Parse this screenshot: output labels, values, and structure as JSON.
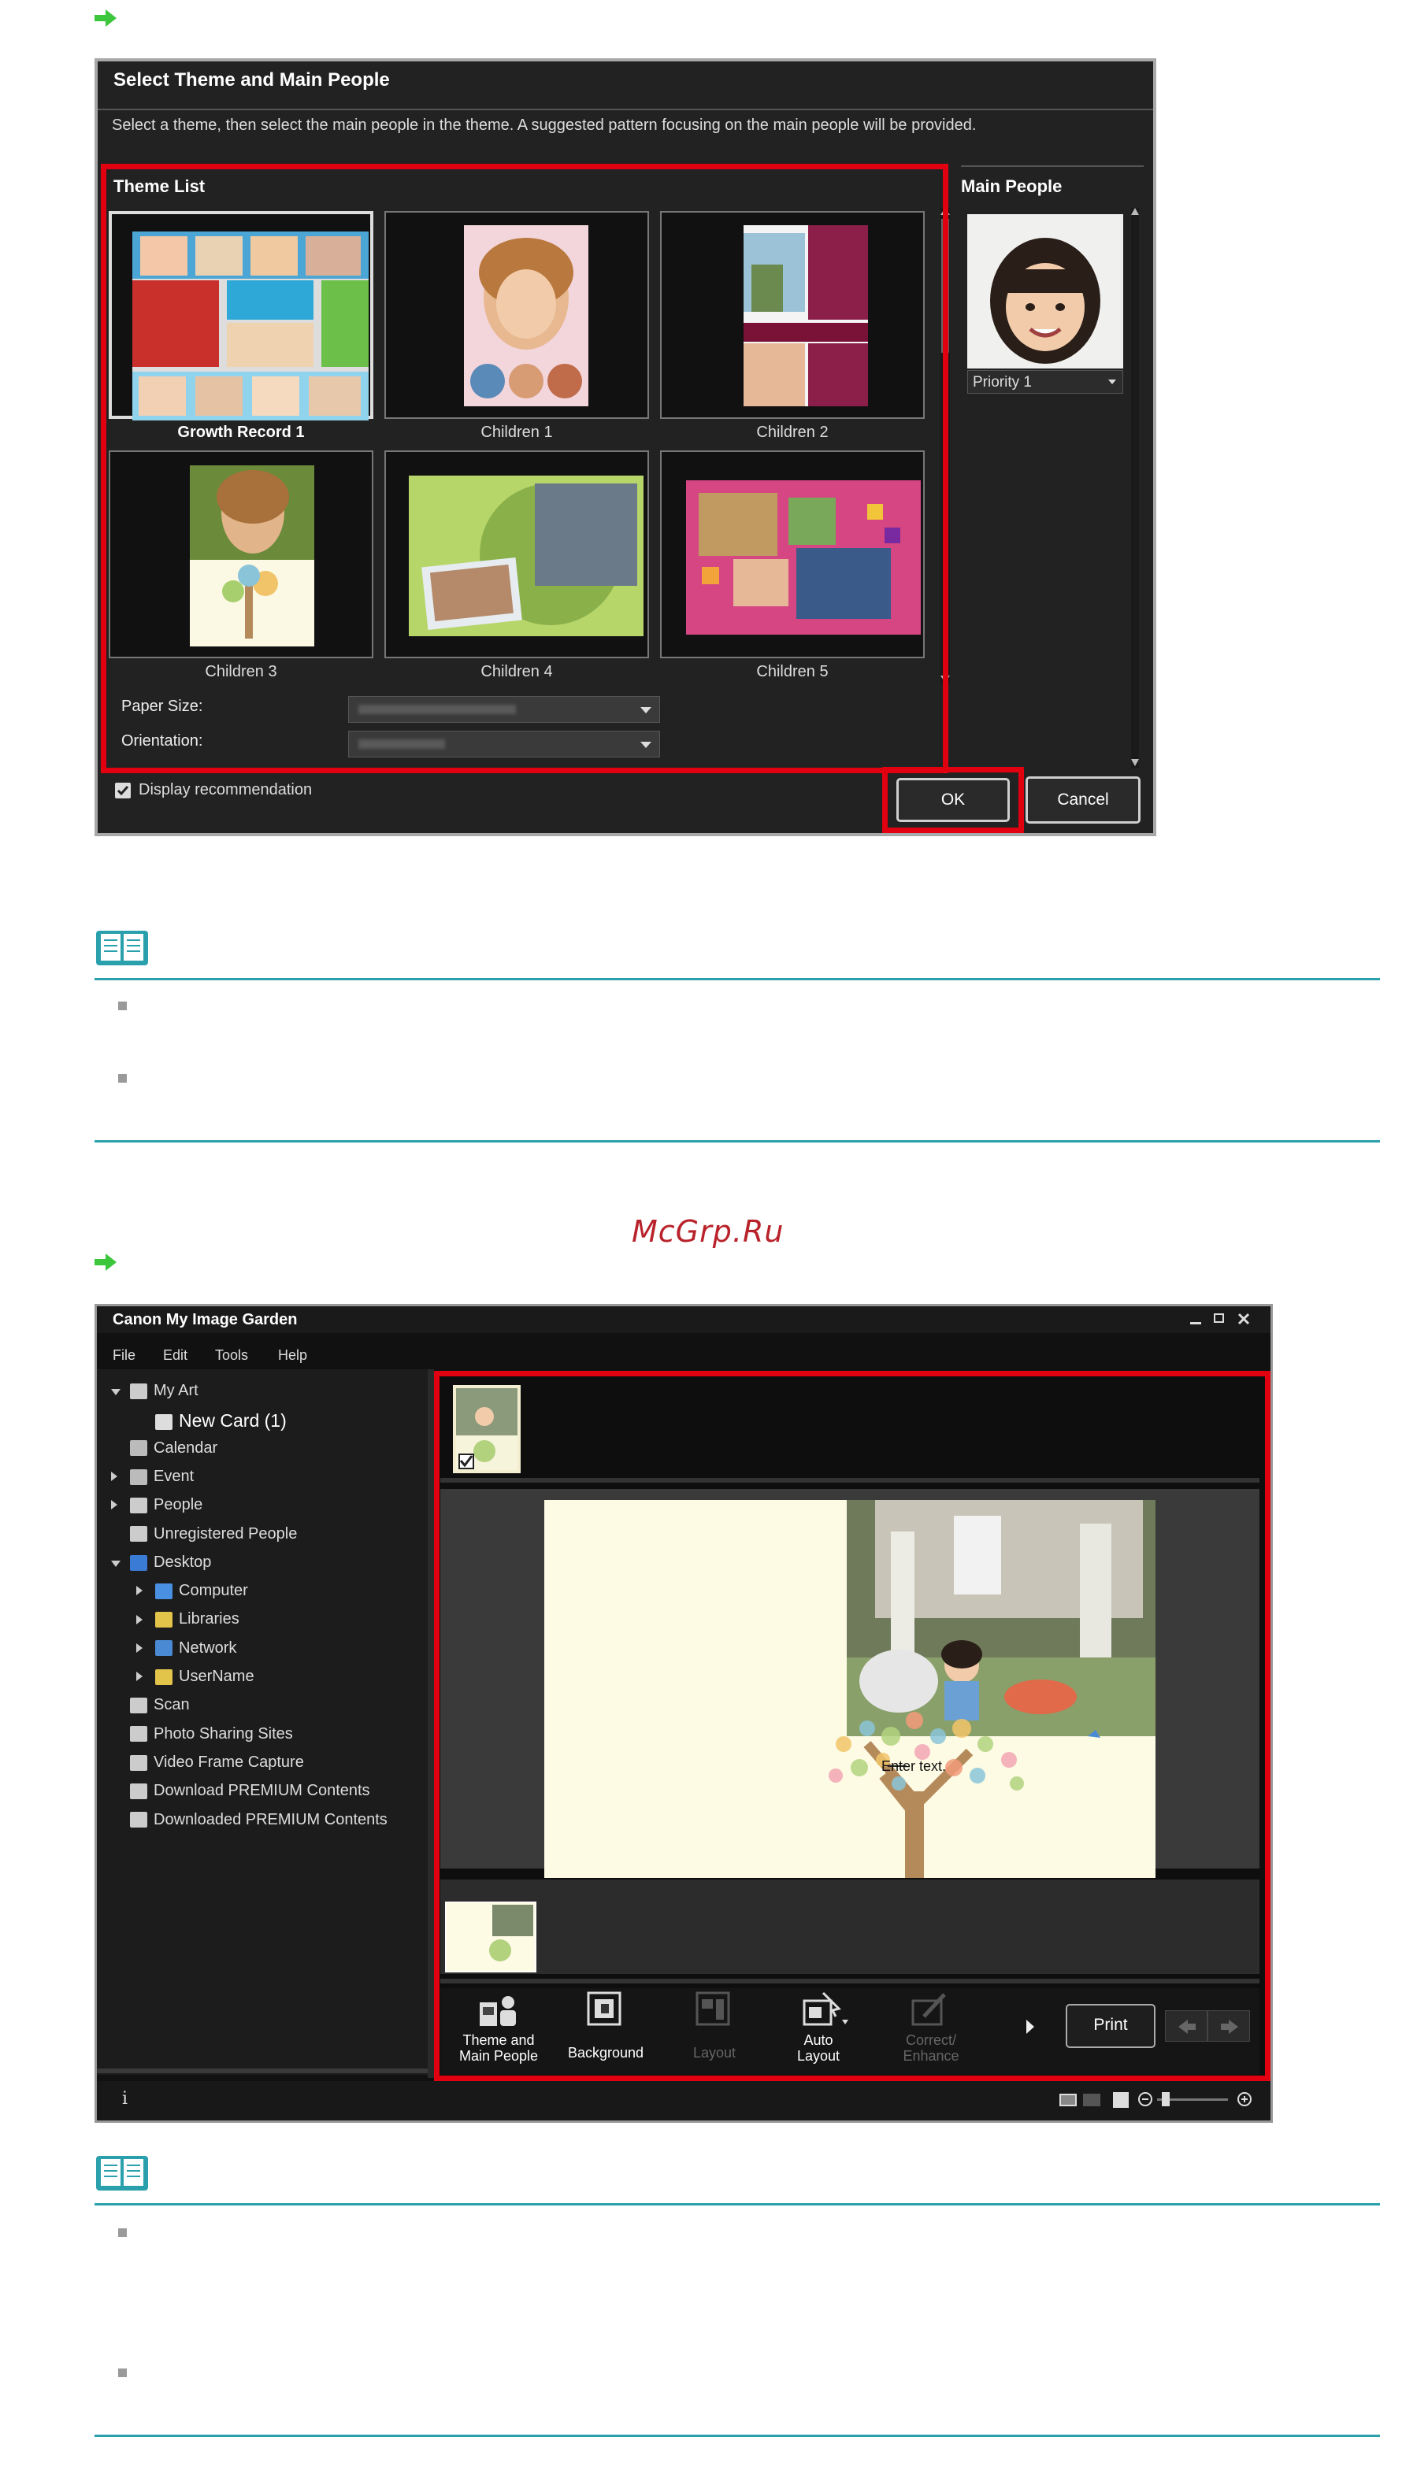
{
  "dialog": {
    "title": "Select Theme and Main People",
    "description": "Select a theme, then select the main people in the theme. A suggested pattern focusing on the main people will be provided.",
    "theme_list_title": "Theme List",
    "themes": [
      {
        "label": "Growth Record 1",
        "selected": true
      },
      {
        "label": "Children 1",
        "selected": false
      },
      {
        "label": "Children 2",
        "selected": false
      },
      {
        "label": "Children 3",
        "selected": false
      },
      {
        "label": "Children 4",
        "selected": false
      },
      {
        "label": "Children 5",
        "selected": false
      }
    ],
    "paper_size_label": "Paper Size:",
    "orientation_label": "Orientation:",
    "main_people_title": "Main People",
    "priority_value": "Priority 1",
    "display_recommendation_label": "Display recommendation",
    "display_recommendation_checked": true,
    "ok_label": "OK",
    "cancel_label": "Cancel"
  },
  "watermark": "McGrp.Ru",
  "app": {
    "title": "Canon My Image Garden",
    "menu": [
      "File",
      "Edit",
      "Tools",
      "Help"
    ],
    "tree": [
      {
        "label": "My Art",
        "icon": "my-art-icon",
        "level": 0,
        "arrow": "expanded"
      },
      {
        "label": "New Card (1)",
        "icon": "card-icon",
        "level": 1,
        "arrow": "",
        "selected": true
      },
      {
        "label": "Calendar",
        "icon": "calendar-icon",
        "level": 0,
        "arrow": ""
      },
      {
        "label": "Event",
        "icon": "event-icon",
        "level": 0,
        "arrow": "collapsed"
      },
      {
        "label": "People",
        "icon": "person-icon",
        "level": 0,
        "arrow": "collapsed"
      },
      {
        "label": "Unregistered People",
        "icon": "unregistered-person-icon",
        "level": 0,
        "arrow": ""
      },
      {
        "label": "Desktop",
        "icon": "desktop-icon",
        "level": 0,
        "arrow": "expanded"
      },
      {
        "label": "Computer",
        "icon": "computer-icon",
        "level": 1,
        "arrow": "collapsed"
      },
      {
        "label": "Libraries",
        "icon": "libraries-icon",
        "level": 1,
        "arrow": "collapsed"
      },
      {
        "label": "Network",
        "icon": "network-icon",
        "level": 1,
        "arrow": "collapsed"
      },
      {
        "label": "UserName",
        "icon": "user-folder-icon",
        "level": 1,
        "arrow": "collapsed"
      },
      {
        "label": "Scan",
        "icon": "scan-icon",
        "level": 0,
        "arrow": ""
      },
      {
        "label": "Photo Sharing Sites",
        "icon": "photo-sharing-icon",
        "level": 0,
        "arrow": ""
      },
      {
        "label": "Video Frame Capture",
        "icon": "video-frame-icon",
        "level": 0,
        "arrow": ""
      },
      {
        "label": "Download PREMIUM Contents",
        "icon": "download-icon",
        "level": 0,
        "arrow": ""
      },
      {
        "label": "Downloaded PREMIUM Contents",
        "icon": "folder-icon",
        "level": 0,
        "arrow": ""
      }
    ],
    "canvas_text": "Enter text.",
    "toolbar": {
      "theme_label_1": "Theme and",
      "theme_label_2": "Main People",
      "background_label": "Background",
      "layout_label": "Layout",
      "auto_layout_label_1": "Auto",
      "auto_layout_label_2": "Layout",
      "correct_label_1": "Correct/",
      "correct_label_2": "Enhance",
      "print_label": "Print"
    },
    "info_label": "i"
  },
  "colors": {
    "highlight_red": "#e00010",
    "note_teal": "#2aa0ad",
    "arrow_green": "#3cc63c"
  }
}
